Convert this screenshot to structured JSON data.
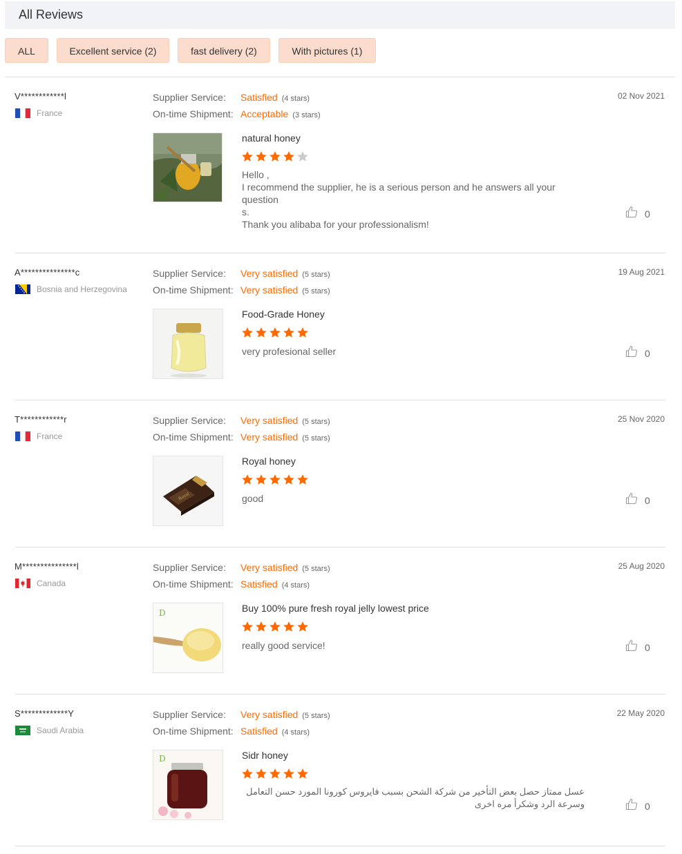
{
  "header": {
    "title": "All Reviews"
  },
  "filters": [
    {
      "label": "ALL"
    },
    {
      "label": "Excellent service (2)"
    },
    {
      "label": "fast delivery (2)"
    },
    {
      "label": "With pictures (1)"
    }
  ],
  "labels": {
    "supplier_service": "Supplier Service:",
    "ontime_shipment": "On-time Shipment:"
  },
  "colors": {
    "accent": "#ff6a00",
    "star_empty": "#cccccc",
    "filter_bg": "#fcdccc"
  },
  "reviews": [
    {
      "user": "V************l",
      "country": "France",
      "flag": "france",
      "date": "02 Nov 2021",
      "supplier_value": "Satisfied",
      "supplier_stars": "(4 stars)",
      "shipment_value": "Acceptable",
      "shipment_stars": "(3 stars)",
      "product": "natural honey",
      "rating": 4,
      "comment": "Hello ,\nI recommend the supplier, he is a serious person and he answers all your question\ns.\nThank you alibaba for your professionalism!",
      "likes": "0",
      "image": "honey-dipper-photo"
    },
    {
      "user": "A***************c",
      "country": "Bosnia and Herzegovina",
      "flag": "bosnia",
      "date": "19 Aug 2021",
      "supplier_value": "Very satisfied",
      "supplier_stars": "(5 stars)",
      "shipment_value": "Very satisfied",
      "shipment_stars": "(5 stars)",
      "product": "Food-Grade Honey",
      "rating": 5,
      "comment": "very profesional seller",
      "likes": "0",
      "image": "glass-honey-jar-photo"
    },
    {
      "user": "T************r",
      "country": "France",
      "flag": "france",
      "date": "25 Nov 2020",
      "supplier_value": "Very satisfied",
      "supplier_stars": "(5 stars)",
      "shipment_value": "Very satisfied",
      "shipment_stars": "(5 stars)",
      "product": "Royal honey",
      "rating": 5,
      "comment": "good",
      "likes": "0",
      "image": "royal-honey-box-photo"
    },
    {
      "user": "M***************l",
      "country": "Canada",
      "flag": "canada",
      "date": "25 Aug 2020",
      "supplier_value": "Very satisfied",
      "supplier_stars": "(5 stars)",
      "shipment_value": "Satisfied",
      "shipment_stars": "(4 stars)",
      "product": "Buy 100% pure fresh royal jelly lowest price",
      "rating": 5,
      "comment": "really good service!",
      "likes": "0",
      "image": "royal-jelly-spoon-photo"
    },
    {
      "user": "S*************Y",
      "country": "Saudi Arabia",
      "flag": "saudi",
      "date": "22 May 2020",
      "supplier_value": "Very satisfied",
      "supplier_stars": "(5 stars)",
      "shipment_value": "Satisfied",
      "shipment_stars": "(4 stars)",
      "product": "Sidr honey",
      "rating": 5,
      "comment": "عسل ممتاز حصل بعض التأخير  من شركة الشحن بسبب فايروس كورونا المورد حسن التعامل وسرعة الرد  وشكرأ مره اخرى",
      "likes": "0",
      "image": "sidr-honey-jar-photo"
    }
  ]
}
